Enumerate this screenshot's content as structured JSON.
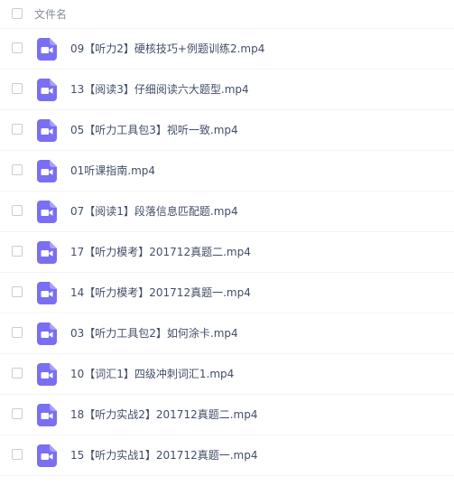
{
  "header": {
    "column_label": "文件名"
  },
  "files": [
    {
      "name": "09【听力2】硬核技巧+例题训练2.mp4",
      "icon": "video-file-icon"
    },
    {
      "name": "13【阅读3】仔细阅读六大题型.mp4",
      "icon": "video-file-icon"
    },
    {
      "name": "05【听力工具包3】视听一致.mp4",
      "icon": "video-file-icon"
    },
    {
      "name": "01听课指南.mp4",
      "icon": "video-file-icon"
    },
    {
      "name": "07【阅读1】段落信息匹配题.mp4",
      "icon": "video-file-icon"
    },
    {
      "name": "17【听力模考】201712真题二.mp4",
      "icon": "video-file-icon"
    },
    {
      "name": "14【听力模考】201712真题一.mp4",
      "icon": "video-file-icon"
    },
    {
      "name": "03【听力工具包2】如何涂卡.mp4",
      "icon": "video-file-icon"
    },
    {
      "name": "10【词汇1】四级冲刺词汇1.mp4",
      "icon": "video-file-icon"
    },
    {
      "name": "18【听力实战2】201712真题二.mp4",
      "icon": "video-file-icon"
    },
    {
      "name": "15【听力实战1】201712真题一.mp4",
      "icon": "video-file-icon"
    }
  ],
  "colors": {
    "icon_purple": "#7a6ef2",
    "text": "#424e67",
    "header_text": "#878c9c",
    "divider": "#f2f4f7"
  }
}
